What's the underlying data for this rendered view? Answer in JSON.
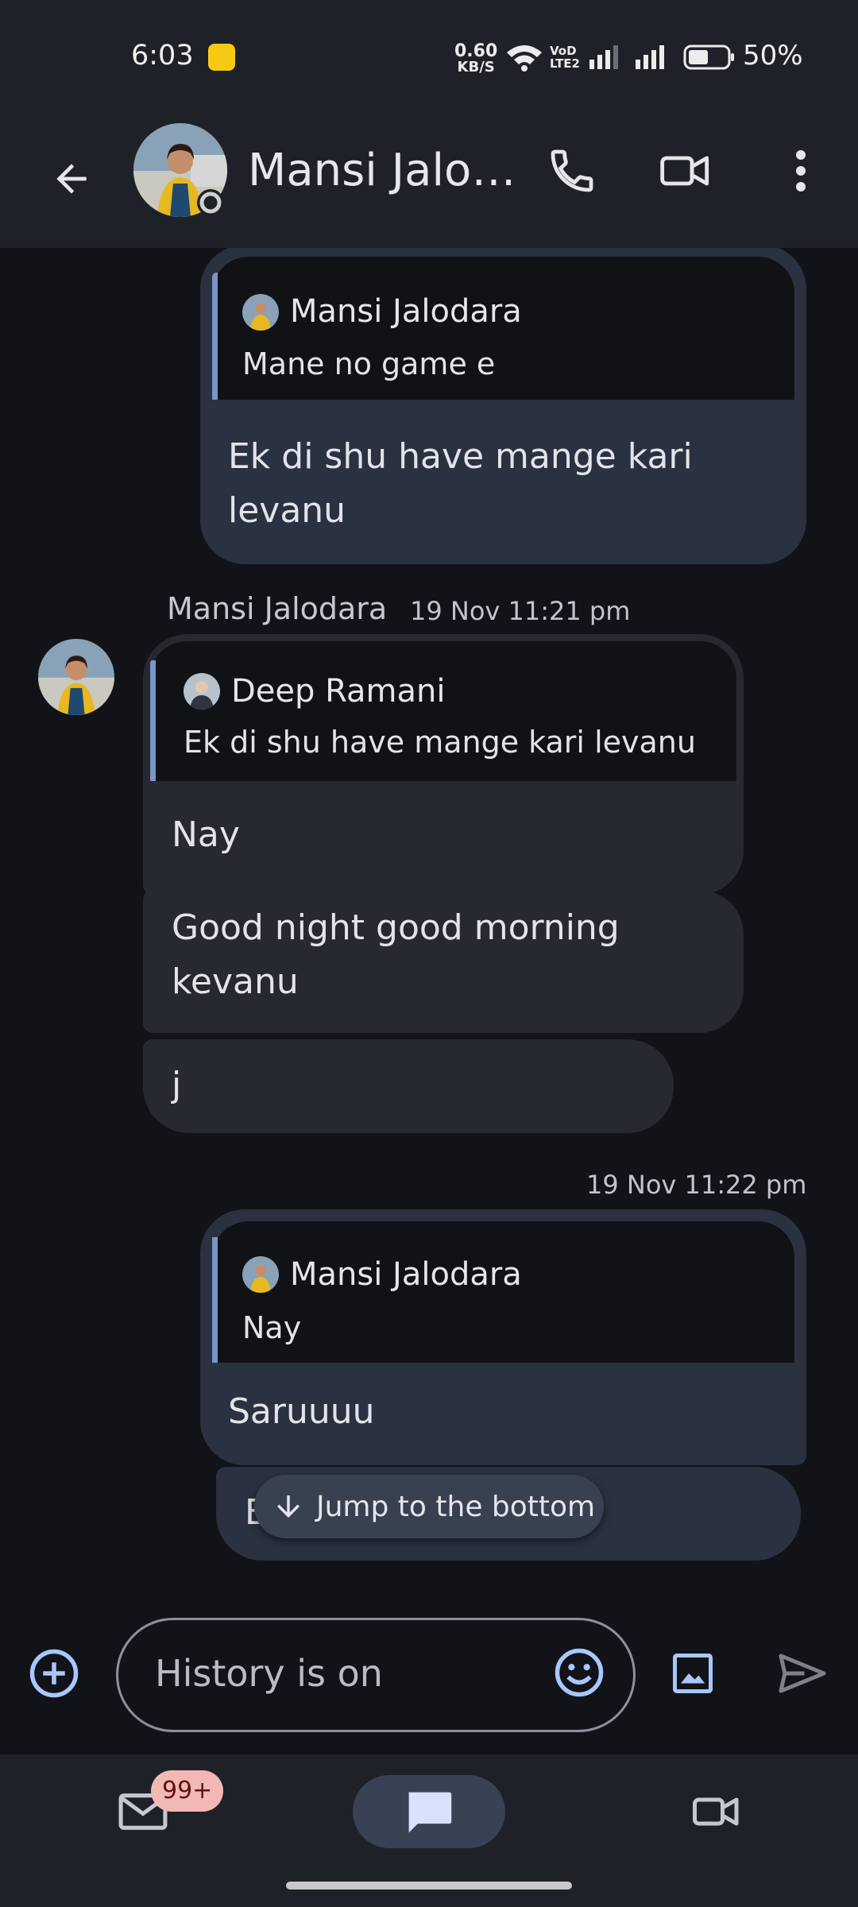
{
  "status_bar": {
    "time": "6:03",
    "net_speed_value": "0.60",
    "net_speed_unit": "KB/S",
    "volte_top": "VoD",
    "volte_bottom": "LTE2",
    "battery_percent": "50%"
  },
  "header": {
    "contact_name": "Mansi Jalo…",
    "icons": [
      "back-arrow-icon",
      "phone-icon",
      "video-call-icon",
      "more-vert-icon"
    ]
  },
  "messages": {
    "m1": {
      "quote_sender": "Mansi Jalodara",
      "quote_text": "Mane no game e",
      "text": "Ek di shu have mange kari levanu"
    },
    "m2": {
      "sender": "Mansi Jalodara",
      "time": "19 Nov 11:21 pm",
      "quote_sender": "Deep Ramani",
      "quote_text": "Ek di shu have mange kari levanu",
      "text": "Nay"
    },
    "m3": {
      "text": "Good night good morning kevanu"
    },
    "m4": {
      "text": "j"
    },
    "m5": {
      "time": "19 Nov 11:22 pm",
      "quote_sender": "Mansi Jalodara",
      "quote_text": "Nay",
      "text": "Saruuuu"
    },
    "m6": {
      "text": "E"
    }
  },
  "jump_button": {
    "label": "Jump to the bottom"
  },
  "composer": {
    "placeholder": "History is on",
    "icons": [
      "add-circle-icon",
      "emoji-icon",
      "image-icon",
      "send-icon"
    ]
  },
  "bottom_nav": {
    "mail_badge": "99+",
    "items": [
      "mail-icon",
      "chat-icon",
      "meet-icon"
    ]
  },
  "colors": {
    "background": "#111318",
    "bar": "#1e2228",
    "my_bubble": "#2a3140",
    "their_bubble": "#26292f",
    "accent": "#a8c7fa",
    "quote_bar": "#7b95c8"
  }
}
